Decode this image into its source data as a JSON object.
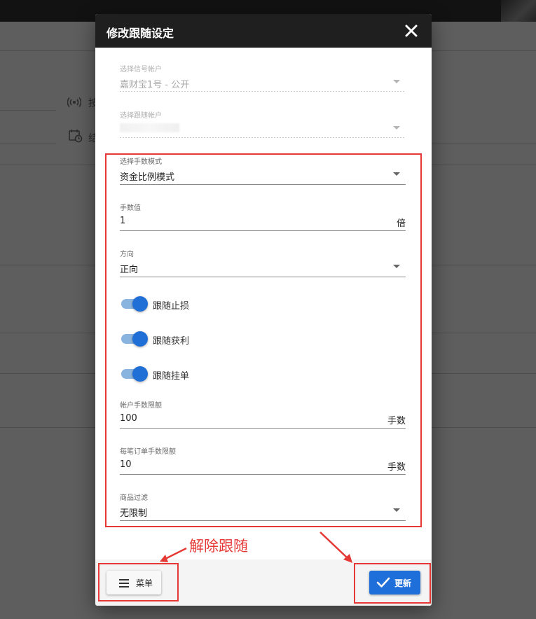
{
  "dialog": {
    "title": "修改跟随设定",
    "close_icon": "close-icon"
  },
  "fields": {
    "signal_account": {
      "label": "选择信号帐户",
      "value": "嘉财宝1号 - 公开"
    },
    "follow_account": {
      "label": "选择跟随帐户",
      "value": ""
    },
    "lot_mode": {
      "label": "选择手数模式",
      "value": "资金比例模式"
    },
    "lot_value": {
      "label": "手数值",
      "value": "1",
      "suffix": "倍"
    },
    "direction": {
      "label": "方向",
      "value": "正向"
    },
    "account_lot_limit": {
      "label": "帐户手数限额",
      "value": "100",
      "suffix": "手数"
    },
    "order_lot_limit": {
      "label": "每笔订单手数限额",
      "value": "10",
      "suffix": "手数"
    },
    "symbol_filter": {
      "label": "商品过滤",
      "value": "无限制"
    }
  },
  "toggles": [
    {
      "label": "跟随止损",
      "on": true
    },
    {
      "label": "跟随获利",
      "on": true
    },
    {
      "label": "跟随挂单",
      "on": true
    }
  ],
  "footer": {
    "menu_label": "菜单",
    "update_label": "更新"
  },
  "annotation": {
    "text": "解除跟随",
    "color": "#e53935"
  },
  "background": {
    "icons": [
      "broadcast-icon",
      "calendar-clock-icon"
    ],
    "char_1": "按",
    "char_2": "结"
  },
  "colors": {
    "accent": "#1e6fd9",
    "header": "#1f1f1f",
    "highlight": "#e53935"
  }
}
